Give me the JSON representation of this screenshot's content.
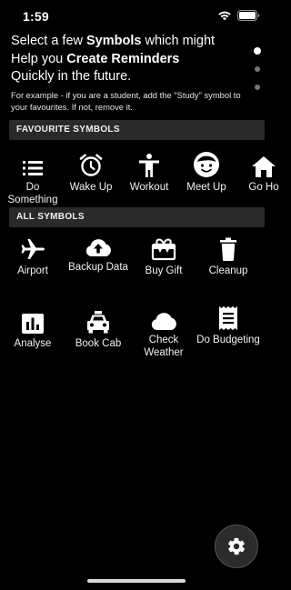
{
  "status": {
    "time": "1:59"
  },
  "intro": {
    "line1_pre": "Select a few ",
    "line1_bold": "Symbols",
    "line1_post": " which might",
    "line2_pre": "Help you ",
    "line2_bold": "Create Reminders",
    "line3": "Quickly in the future.",
    "example": "For example - if you are a student, add the \"Study\" symbol to your favourites. If not, remove it."
  },
  "page_indicator": {
    "count": 3,
    "active": 1
  },
  "favourites": {
    "header": "FAVOURITE SYMBOLS",
    "items": [
      {
        "label": "Do Something",
        "icon": "list-icon"
      },
      {
        "label": "Wake Up",
        "icon": "alarm-clock-icon"
      },
      {
        "label": "Workout",
        "icon": "person-icon"
      },
      {
        "label": "Meet Up",
        "icon": "face-icon"
      },
      {
        "label": "Go Ho",
        "icon": "home-icon"
      }
    ]
  },
  "all_symbols": {
    "header": "ALL SYMBOLS",
    "items": [
      {
        "label": "Airport",
        "icon": "airplane-icon"
      },
      {
        "label": "Backup Data",
        "icon": "cloud-upload-icon"
      },
      {
        "label": "Buy Gift",
        "icon": "gift-icon"
      },
      {
        "label": "Cleanup",
        "icon": "trash-icon"
      },
      {
        "label": "Analyse",
        "icon": "bar-chart-icon"
      },
      {
        "label": "Book Cab",
        "icon": "taxi-icon"
      },
      {
        "label": "Check Weather",
        "icon": "cloud-icon"
      },
      {
        "label": "Do Budgeting",
        "icon": "receipt-icon"
      }
    ]
  },
  "settings_button": {
    "icon": "gear-icon"
  },
  "colors": {
    "background": "#000000",
    "header_bg": "#2a2a2a",
    "text": "#ffffff"
  }
}
